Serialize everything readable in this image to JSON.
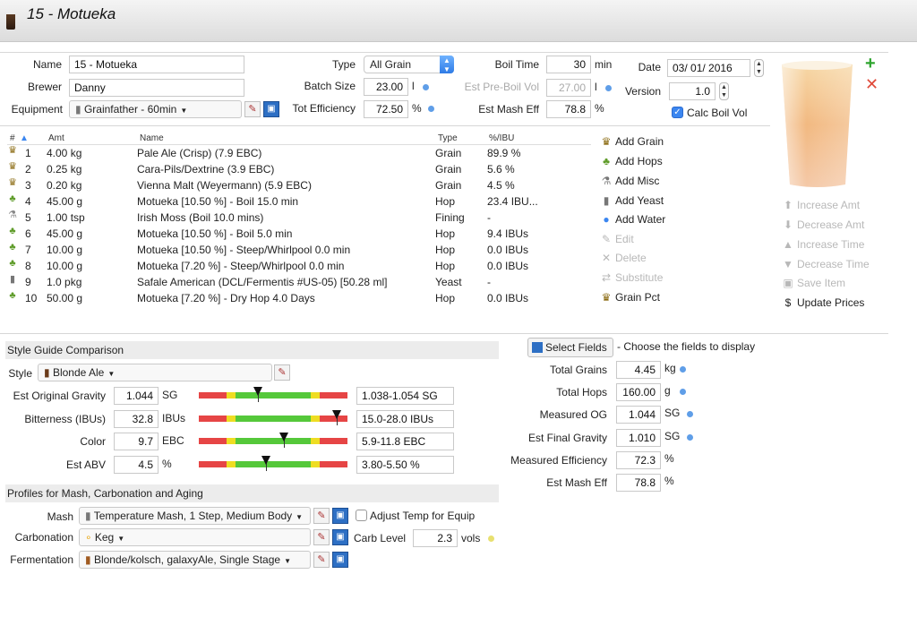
{
  "window": {
    "title": "15 - Motueka"
  },
  "recipe": {
    "name_label": "Name",
    "name": "15 - Motueka",
    "brewer_label": "Brewer",
    "brewer": "Danny",
    "equipment_label": "Equipment",
    "equipment": "Grainfather - 60min",
    "type_label": "Type",
    "type": "All Grain",
    "batch_size_label": "Batch Size",
    "batch_size": "23.00",
    "batch_size_unit": "l",
    "tot_efficiency_label": "Tot Efficiency",
    "tot_efficiency": "72.50",
    "tot_efficiency_unit": "%",
    "boil_time_label": "Boil Time",
    "boil_time": "30",
    "boil_time_unit": "min",
    "pre_boil_label": "Est Pre-Boil Vol",
    "pre_boil": "27.00",
    "pre_boil_unit": "l",
    "mash_eff_label": "Est Mash Eff",
    "mash_eff": "78.8",
    "mash_eff_unit": "%",
    "date_label": "Date",
    "date": "03/ 01/ 2016",
    "version_label": "Version",
    "version": "1.0",
    "calc_boil_label": "Calc Boil Vol",
    "calc_boil_checked": true
  },
  "ingredients": {
    "headers": {
      "num": "#",
      "amt": "Amt",
      "name": "Name",
      "type": "Type",
      "pct": "%/IBU"
    },
    "rows": [
      {
        "icon": "grain-icon",
        "num": "1",
        "amt": "4.00 kg",
        "name": "Pale Ale (Crisp) (7.9 EBC)",
        "type": "Grain",
        "pct": "89.9 %"
      },
      {
        "icon": "grain-icon",
        "num": "2",
        "amt": "0.25 kg",
        "name": "Cara-Pils/Dextrine (3.9 EBC)",
        "type": "Grain",
        "pct": "5.6 %"
      },
      {
        "icon": "grain-icon",
        "num": "3",
        "amt": "0.20 kg",
        "name": "Vienna Malt (Weyermann) (5.9 EBC)",
        "type": "Grain",
        "pct": "4.5 %"
      },
      {
        "icon": "hop-icon",
        "num": "4",
        "amt": "45.00 g",
        "name": "Motueka [10.50 %] - Boil 15.0 min",
        "type": "Hop",
        "pct": "23.4 IBU..."
      },
      {
        "icon": "fining-icon",
        "num": "5",
        "amt": "1.00 tsp",
        "name": "Irish Moss (Boil 10.0 mins)",
        "type": "Fining",
        "pct": "-"
      },
      {
        "icon": "hop-icon",
        "num": "6",
        "amt": "45.00 g",
        "name": "Motueka [10.50 %] - Boil 5.0 min",
        "type": "Hop",
        "pct": "9.4 IBUs"
      },
      {
        "icon": "hop-icon",
        "num": "7",
        "amt": "10.00 g",
        "name": "Motueka [10.50 %] - Steep/Whirlpool  0.0 min",
        "type": "Hop",
        "pct": "0.0 IBUs"
      },
      {
        "icon": "hop-icon",
        "num": "8",
        "amt": "10.00 g",
        "name": "Motueka [7.20 %] - Steep/Whirlpool  0.0 min",
        "type": "Hop",
        "pct": "0.0 IBUs"
      },
      {
        "icon": "yeast-icon",
        "num": "9",
        "amt": "1.0 pkg",
        "name": "Safale American  (DCL/Fermentis #US-05) [50.28 ml]",
        "type": "Yeast",
        "pct": "-"
      },
      {
        "icon": "hop-icon",
        "num": "10",
        "amt": "50.00 g",
        "name": "Motueka [7.20 %] - Dry Hop 4.0 Days",
        "type": "Hop",
        "pct": "0.0 IBUs"
      }
    ]
  },
  "actions": {
    "add_grain": "Add Grain",
    "add_hops": "Add Hops",
    "add_misc": "Add Misc",
    "add_yeast": "Add Yeast",
    "add_water": "Add Water",
    "edit": "Edit",
    "delete": "Delete",
    "substitute": "Substitute",
    "grain_pct": "Grain Pct",
    "increase_amt": "Increase Amt",
    "decrease_amt": "Decrease Amt",
    "increase_time": "Increase Time",
    "decrease_time": "Decrease Time",
    "save_item": "Save Item",
    "update_prices": "Update Prices"
  },
  "style_guide": {
    "title": "Style Guide Comparison",
    "style_label": "Style",
    "style": "Blonde Ale",
    "rows": [
      {
        "label": "Est Original Gravity",
        "value": "1.044",
        "unit": "SG",
        "range": "1.038-1.054 SG",
        "level": 0.4
      },
      {
        "label": "Bitterness (IBUs)",
        "value": "32.8",
        "unit": "IBUs",
        "range": "15.0-28.0 IBUs",
        "level": 0.93
      },
      {
        "label": "Color",
        "value": "9.7",
        "unit": "EBC",
        "range": "5.9-11.8 EBC",
        "level": 0.57
      },
      {
        "label": "Est ABV",
        "value": "4.5",
        "unit": "%",
        "range": "3.80-5.50 %",
        "level": 0.45
      }
    ]
  },
  "fields_panel": {
    "select_fields": "Select Fields",
    "hint": "- Choose the fields to display",
    "rows": [
      {
        "label": "Total Grains",
        "value": "4.45",
        "unit": "kg"
      },
      {
        "label": "Total Hops",
        "value": "160.00",
        "unit": "g"
      },
      {
        "label": "Measured OG",
        "value": "1.044",
        "unit": "SG"
      },
      {
        "label": "Est Final Gravity",
        "value": "1.010",
        "unit": "SG"
      },
      {
        "label": "Measured Efficiency",
        "value": "72.3",
        "unit": "%"
      },
      {
        "label": "Est Mash Eff",
        "value": "78.8",
        "unit": "%"
      }
    ]
  },
  "profiles": {
    "title": "Profiles for Mash, Carbonation and Aging",
    "mash_label": "Mash",
    "mash": "Temperature Mash, 1 Step, Medium Body",
    "adjust_temp_label": "Adjust Temp for Equip",
    "carbonation_label": "Carbonation",
    "carbonation": "Keg",
    "carb_level_label": "Carb Level",
    "carb_level": "2.3",
    "carb_level_unit": "vols",
    "fermentation_label": "Fermentation",
    "fermentation": "Blonde/kolsch, galaxyAle, Single Stage"
  },
  "colors": {
    "accent": "#3b86f0",
    "bar_red": "#e64545",
    "bar_yellow": "#eedd22",
    "bar_green": "#55c83a"
  }
}
